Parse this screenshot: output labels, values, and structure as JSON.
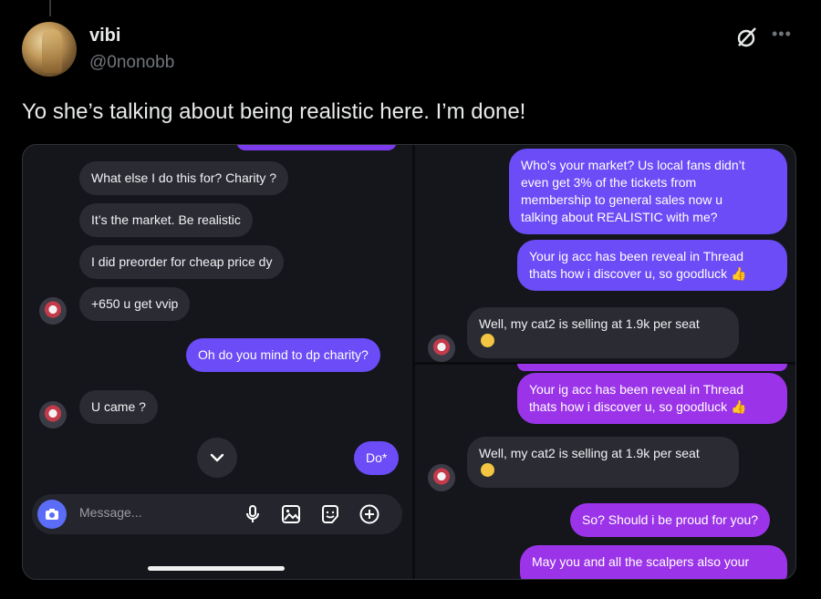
{
  "tweet": {
    "display_name": "vibi",
    "handle": "@0nonobb",
    "text": "Yo she’s talking about being realistic here. I’m done!"
  },
  "left_chat": {
    "messages": [
      {
        "text": "What else I do this for? Charity ?",
        "side": "incoming"
      },
      {
        "text": "It’s the market. Be realistic",
        "side": "incoming"
      },
      {
        "text": "I did preorder for cheap price dy",
        "side": "incoming"
      },
      {
        "text": "+650 u get vvip",
        "side": "incoming"
      },
      {
        "text": "Oh do you mind to dp charity?",
        "side": "outgoing"
      },
      {
        "text": "U came ?",
        "side": "incoming"
      },
      {
        "text": "Do*",
        "side": "outgoing"
      }
    ],
    "composer": {
      "placeholder": "Message..."
    }
  },
  "right_top_chat": {
    "messages": [
      {
        "lines": [
          "Who’s your market? Us local fans didn’t",
          "even get 3% of the tickets from",
          "membership to general sales now u",
          "talking about REALISTIC with me?"
        ],
        "side": "outgoing"
      },
      {
        "lines": [
          "Your ig acc has been reveal in Thread",
          "thats how i discover u, so goodluck"
        ],
        "side": "outgoing"
      },
      {
        "lines": [
          "Well, my cat2 is selling at 1.9k per seat"
        ],
        "side": "incoming"
      }
    ]
  },
  "right_bottom_chat": {
    "messages": [
      {
        "lines": [
          "Your ig acc has been reveal in Thread",
          "thats how i discover u, so goodluck"
        ],
        "side": "outgoing"
      },
      {
        "lines": [
          "Well, my cat2 is selling at 1.9k per seat"
        ],
        "side": "incoming"
      },
      {
        "lines": [
          "So? Should i be proud for you?"
        ],
        "side": "outgoing"
      },
      {
        "lines": [
          "May you and all the scalpers also your"
        ],
        "side": "outgoing"
      }
    ]
  },
  "colors": {
    "background": "#000000",
    "text": "#e7e9ea",
    "muted": "#71767b",
    "incoming_bubble": "#2b2c33",
    "outgoing_purple": "#7c3aed",
    "outgoing_violet": "#6b4cf6",
    "outgoing_magenta": "#9b34e8"
  },
  "icons": [
    "grok-icon",
    "more-icon",
    "chevron-down-icon",
    "camera-icon",
    "microphone-icon",
    "gallery-icon",
    "sticker-icon",
    "plus-icon",
    "thumbs-up-emoji",
    "relieved-emoji"
  ]
}
